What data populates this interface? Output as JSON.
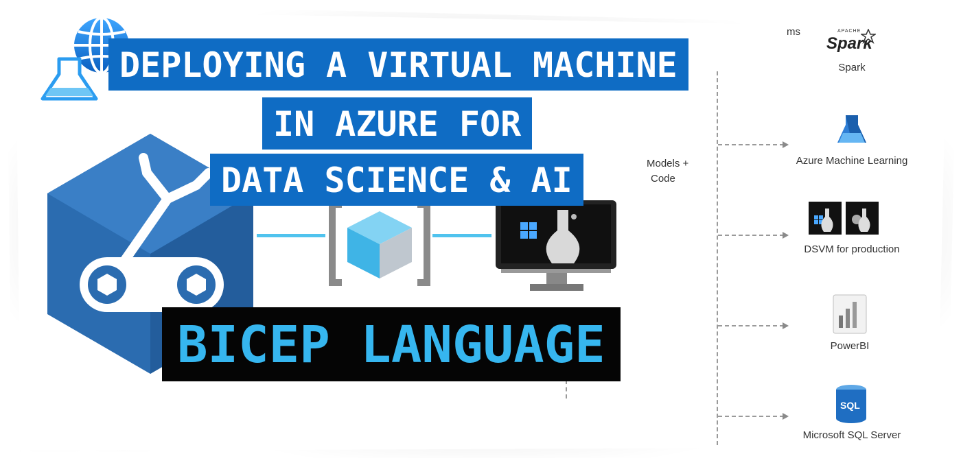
{
  "title_lines": [
    "DEPLOYING A VIRTUAL MACHINE",
    "IN AZURE FOR",
    "DATA SCIENCE & AI"
  ],
  "subtitle": "BICEP LANGUAGE",
  "diagram": {
    "partial_label_top": "ms",
    "models_label_line1": "Models +",
    "models_label_line2": "Code",
    "services": [
      {
        "label": "Spark",
        "icon": "spark-logo"
      },
      {
        "label": "Azure Machine Learning",
        "icon": "azure-ml-icon"
      },
      {
        "label": "DSVM for production",
        "icon": "dsvm-icon"
      },
      {
        "label": "PowerBI",
        "icon": "powerbi-icon"
      },
      {
        "label": "Microsoft SQL Server",
        "icon": "sql-server-icon"
      }
    ],
    "spark_logo_text": "Spark",
    "spark_logo_small": "APACHE",
    "sql_icon_text": "SQL"
  },
  "colors": {
    "banner_blue": "#0f6cc4",
    "banner_black": "#050505",
    "subtitle_text": "#36b6ef",
    "azure_light": "#50c3ee",
    "azure_dark": "#2b6cb0"
  }
}
